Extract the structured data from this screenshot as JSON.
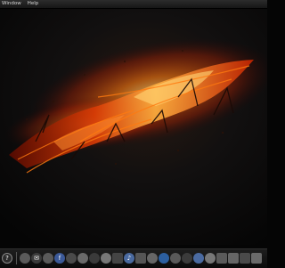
{
  "menubar": {
    "items": [
      "Window",
      "Help"
    ]
  },
  "dock": {
    "apps": [
      {
        "icon": "help-icon",
        "glyph": "?"
      },
      {
        "icon": "safari-icon",
        "glyph": ""
      },
      {
        "icon": "mail-icon",
        "glyph": "✉"
      },
      {
        "icon": "ical-icon",
        "glyph": ""
      },
      {
        "icon": "facebook-icon",
        "glyph": "f"
      },
      {
        "icon": "app-icon-1",
        "glyph": ""
      },
      {
        "icon": "app-icon-2",
        "glyph": ""
      },
      {
        "icon": "ichat-icon",
        "glyph": ""
      },
      {
        "icon": "camera-icon",
        "glyph": ""
      },
      {
        "icon": "photo-booth-icon",
        "glyph": ""
      },
      {
        "icon": "itunes-icon",
        "glyph": "♪"
      },
      {
        "icon": "app-icon-3",
        "glyph": ""
      },
      {
        "icon": "app-icon-4",
        "glyph": ""
      },
      {
        "icon": "app-icon-5",
        "glyph": ""
      },
      {
        "icon": "app-icon-6",
        "glyph": ""
      },
      {
        "icon": "app-icon-7",
        "glyph": ""
      },
      {
        "icon": "itunes-icon-2",
        "glyph": ""
      },
      {
        "icon": "app-icon-8",
        "glyph": ""
      },
      {
        "icon": "app-icon-9",
        "glyph": ""
      },
      {
        "icon": "app-icon-10",
        "glyph": ""
      },
      {
        "icon": "app-icon-11",
        "glyph": ""
      },
      {
        "icon": "app-icon-12",
        "glyph": ""
      },
      {
        "icon": "app-icon-13",
        "glyph": ""
      },
      {
        "icon": "folder-icon",
        "glyph": ""
      },
      {
        "icon": "downloads-icon",
        "glyph": ""
      },
      {
        "icon": "trash-icon",
        "glyph": ""
      }
    ]
  },
  "colors": {
    "flame_orange": "#ff7a10",
    "flame_red": "#c82400",
    "background": "#050505"
  }
}
